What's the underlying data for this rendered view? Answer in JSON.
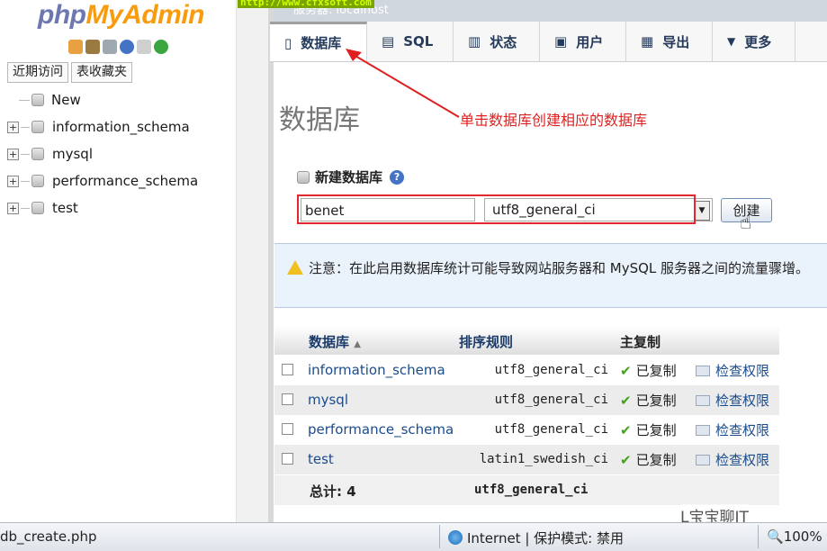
{
  "logo": {
    "php": "php",
    "my": "MyAdmin"
  },
  "nav_tabs": [
    "近期访问",
    "表收藏夹"
  ],
  "tree": [
    {
      "label": "New",
      "expander": ""
    },
    {
      "label": "information_schema",
      "expander": "+"
    },
    {
      "label": "mysql",
      "expander": "+"
    },
    {
      "label": "performance_schema",
      "expander": "+"
    },
    {
      "label": "test",
      "expander": "+"
    }
  ],
  "topbar": {
    "watermark": "http://www.cfxsoft.com",
    "breadcrumb": "服务器: localhost"
  },
  "tabs": [
    {
      "label": "数据库",
      "icon": "database-icon",
      "glyph": "▯"
    },
    {
      "label": "SQL",
      "icon": "sql-icon",
      "glyph": "▤"
    },
    {
      "label": "状态",
      "icon": "status-icon",
      "glyph": "▥"
    },
    {
      "label": "用户",
      "icon": "users-icon",
      "glyph": "▣"
    },
    {
      "label": "导出",
      "icon": "export-icon",
      "glyph": "▦"
    },
    {
      "label": "更多",
      "icon": "chevron-down-icon",
      "glyph": "▼"
    }
  ],
  "page": {
    "title": "数据库",
    "annotation": "单击数据库创建相应的数据库"
  },
  "create_form": {
    "heading": "新建数据库",
    "db_name_value": "benet",
    "collation_value": "utf8_general_ci",
    "create_button": "创建"
  },
  "notice": "注意：在此启用数据库统计可能导致网站服务器和 MySQL 服务器之间的流量骤增。",
  "table": {
    "headers": {
      "database": "数据库",
      "collation": "排序规则",
      "replication": "主复制"
    },
    "rows": [
      {
        "name": "information_schema",
        "collation": "utf8_general_ci",
        "replication": "已复制",
        "privileges": "检查权限"
      },
      {
        "name": "mysql",
        "collation": "utf8_general_ci",
        "replication": "已复制",
        "privileges": "检查权限"
      },
      {
        "name": "performance_schema",
        "collation": "utf8_general_ci",
        "replication": "已复制",
        "privileges": "检查权限"
      },
      {
        "name": "test",
        "collation": "latin1_swedish_ci",
        "replication": "已复制",
        "privileges": "检查权限"
      }
    ],
    "total_label": "总计: 4",
    "total_collation": "utf8_general_ci"
  },
  "statusbar": {
    "url": "db_create.php",
    "zone": "Internet | 保护模式: 禁用",
    "zoom": "100%"
  },
  "watermark_wechat": "L宝宝聊IT"
}
